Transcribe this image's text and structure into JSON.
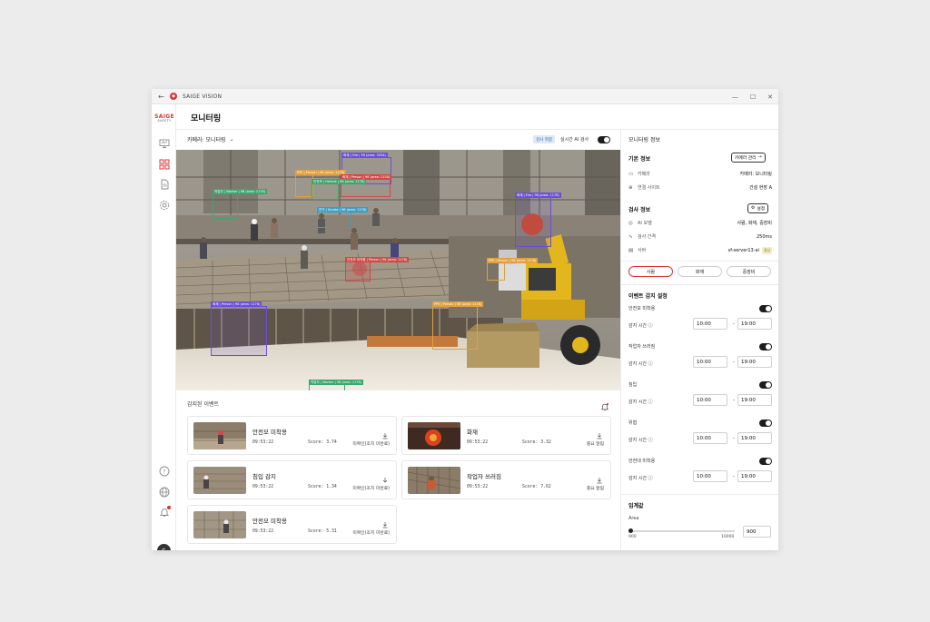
{
  "window": {
    "app_title": "SAIGE VISION",
    "back_icon": "arrow-left-icon",
    "min": "—",
    "max": "☐",
    "close": "✕"
  },
  "brand": {
    "line1": "SAIGE",
    "line2": "SAFETY"
  },
  "sidebar": {
    "items": [
      {
        "name": "monitor-icon"
      },
      {
        "name": "grid-icon",
        "active": true
      },
      {
        "name": "document-icon"
      },
      {
        "name": "settings-icon"
      }
    ],
    "bottom": [
      {
        "name": "help-icon"
      },
      {
        "name": "globe-icon"
      },
      {
        "name": "bell-icon"
      }
    ],
    "avatar": "S"
  },
  "header": {
    "title": "모니터링"
  },
  "camera": {
    "select_label": "카메라: 모니터링",
    "live_badge": "검사 취합",
    "ai_label": "실시간 AI 검사",
    "ai_on": true
  },
  "detections": [
    {
      "label": "화재 | Fire | 99 (area: 3294)",
      "color": "#6b4fd8"
    },
    {
      "label": "PPE | Person | 98 (area: 1178)",
      "color": "#e0a040"
    },
    {
      "label": "화재 | Person | 98 (area: 2150)",
      "color": "#d04848"
    },
    {
      "label": "작업자 | Worker | 98 (area: 1178)",
      "color": "#3aa76d"
    },
    {
      "label": "안전모 | Helmet | 98 (area: 1178)",
      "color": "#3aa76d"
    },
    {
      "label": "연기 | Smoke | 98 (area: 1178)",
      "color": "#3a9fc8"
    },
    {
      "label": "화재 | Fire | 98 (area: 1178)",
      "color": "#6b4fd8"
    },
    {
      "label": "안전모 미착용 | Person | 98 (area: 1178)",
      "color": "#d04848"
    },
    {
      "label": "PPE | Person | 98 (area: 1178)",
      "color": "#e0a040"
    },
    {
      "label": "PPE | Person | 98 (area: 1178)",
      "color": "#e0a040"
    },
    {
      "label": "화재 | Person | 98 (area: 1178)",
      "color": "#6b4fd8"
    },
    {
      "label": "작업자 | Worker | 98 (area: 1178)",
      "color": "#3aa76d"
    }
  ],
  "events": {
    "title": "감지된 이벤트",
    "bell_icon": "bell-plus-icon",
    "items": [
      {
        "name": "안전모 미착용",
        "time": "09:53:22",
        "score": "Score: 3.74",
        "status": "미확인(조치 미완료)",
        "dl_icon": "download-icon"
      },
      {
        "name": "화재",
        "time": "09:53:22",
        "score": "Score: 3.32",
        "status": "중요 알림",
        "dl_icon": "download-icon"
      },
      {
        "name": "침입 감지",
        "time": "09:53:22",
        "score": "Score: 1.34",
        "status": "미확인(조치 미완료)",
        "dl_icon": "arrow-down-icon"
      },
      {
        "name": "작업자 쓰러짐",
        "time": "09:53:22",
        "score": "Score: 7.62",
        "status": "중요 알림",
        "dl_icon": "download-icon"
      },
      {
        "name": "안전모 미착용",
        "time": "09:53:22",
        "score": "Score: 5.31",
        "status": "미확인(조치 미완료)",
        "dl_icon": "download-icon"
      }
    ]
  },
  "panel": {
    "title": "모니터링 정보",
    "basic": {
      "title": "기본 정보",
      "button": "카메라 관리",
      "rows": [
        {
          "icon": "camera-icon",
          "key": "카메라",
          "value": "카메라: 모니터링"
        },
        {
          "icon": "link-icon",
          "key": "연결 사이트",
          "value": "건설 현장 A"
        }
      ]
    },
    "inspect": {
      "title": "검사 정보",
      "button": "설정",
      "rows": [
        {
          "icon": "ai-icon",
          "key": "AI 모델",
          "value": "사람, 화재, 중장비"
        },
        {
          "icon": "interval-icon",
          "key": "검사 간격",
          "value": "250ms"
        },
        {
          "icon": "server-icon",
          "key": "서버",
          "value": "sf-server13-ai",
          "badge": "정상"
        }
      ]
    },
    "tabs": [
      "사람",
      "화재",
      "중장비"
    ],
    "event_settings": {
      "title": "이벤트 감지 설정",
      "time_label": "감지 시간",
      "items": [
        {
          "name": "안전모 미착용",
          "on": true,
          "start": "10:00",
          "end": "19:00"
        },
        {
          "name": "작업자 쓰러짐",
          "on": true,
          "start": "10:00",
          "end": "19:00"
        },
        {
          "name": "침입",
          "on": true,
          "start": "10:00",
          "end": "19:00"
        },
        {
          "name": "위협",
          "on": true,
          "start": "10:00",
          "end": "19:00"
        },
        {
          "name": "안전대 미착용",
          "on": true,
          "start": "10:00",
          "end": "19:00"
        }
      ]
    },
    "threshold": {
      "title": "임계값",
      "area_label": "Area",
      "min": "900",
      "max": "10000",
      "value": "900"
    }
  }
}
